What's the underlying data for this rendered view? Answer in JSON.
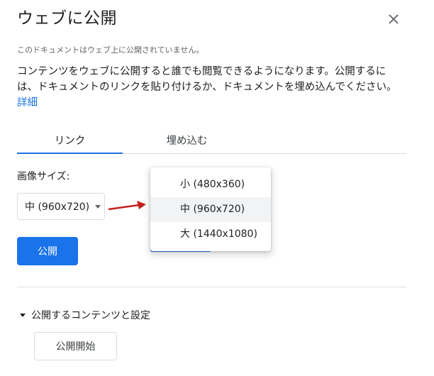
{
  "dialog": {
    "title": "ウェブに公開",
    "close_icon": "close-icon",
    "status_text": "このドキュメントはウェブ上に公開されていません。",
    "description": "コンテンツをウェブに公開すると誰でも閲覧できるようになります。公開するには、ドキュメントのリンクを貼り付けるか、ドキュメントを埋め込んでください。",
    "learn_more_label": "詳細"
  },
  "tabs": [
    {
      "label": "リンク",
      "active": true
    },
    {
      "label": "埋め込む",
      "active": false
    }
  ],
  "image_size": {
    "label": "画像サイズ:",
    "selected": "中 (960x720)",
    "options": [
      {
        "label": "小 (480x360)",
        "selected": false
      },
      {
        "label": "中 (960x720)",
        "selected": true
      },
      {
        "label": "大 (1440x1080)",
        "selected": false
      }
    ]
  },
  "publish_button_label": "公開",
  "published_content": {
    "toggle_label": "公開するコンテンツと設定",
    "start_button_label": "公開開始"
  },
  "colors": {
    "accent": "#1a73e8",
    "annotation_arrow": "#c5221f"
  }
}
